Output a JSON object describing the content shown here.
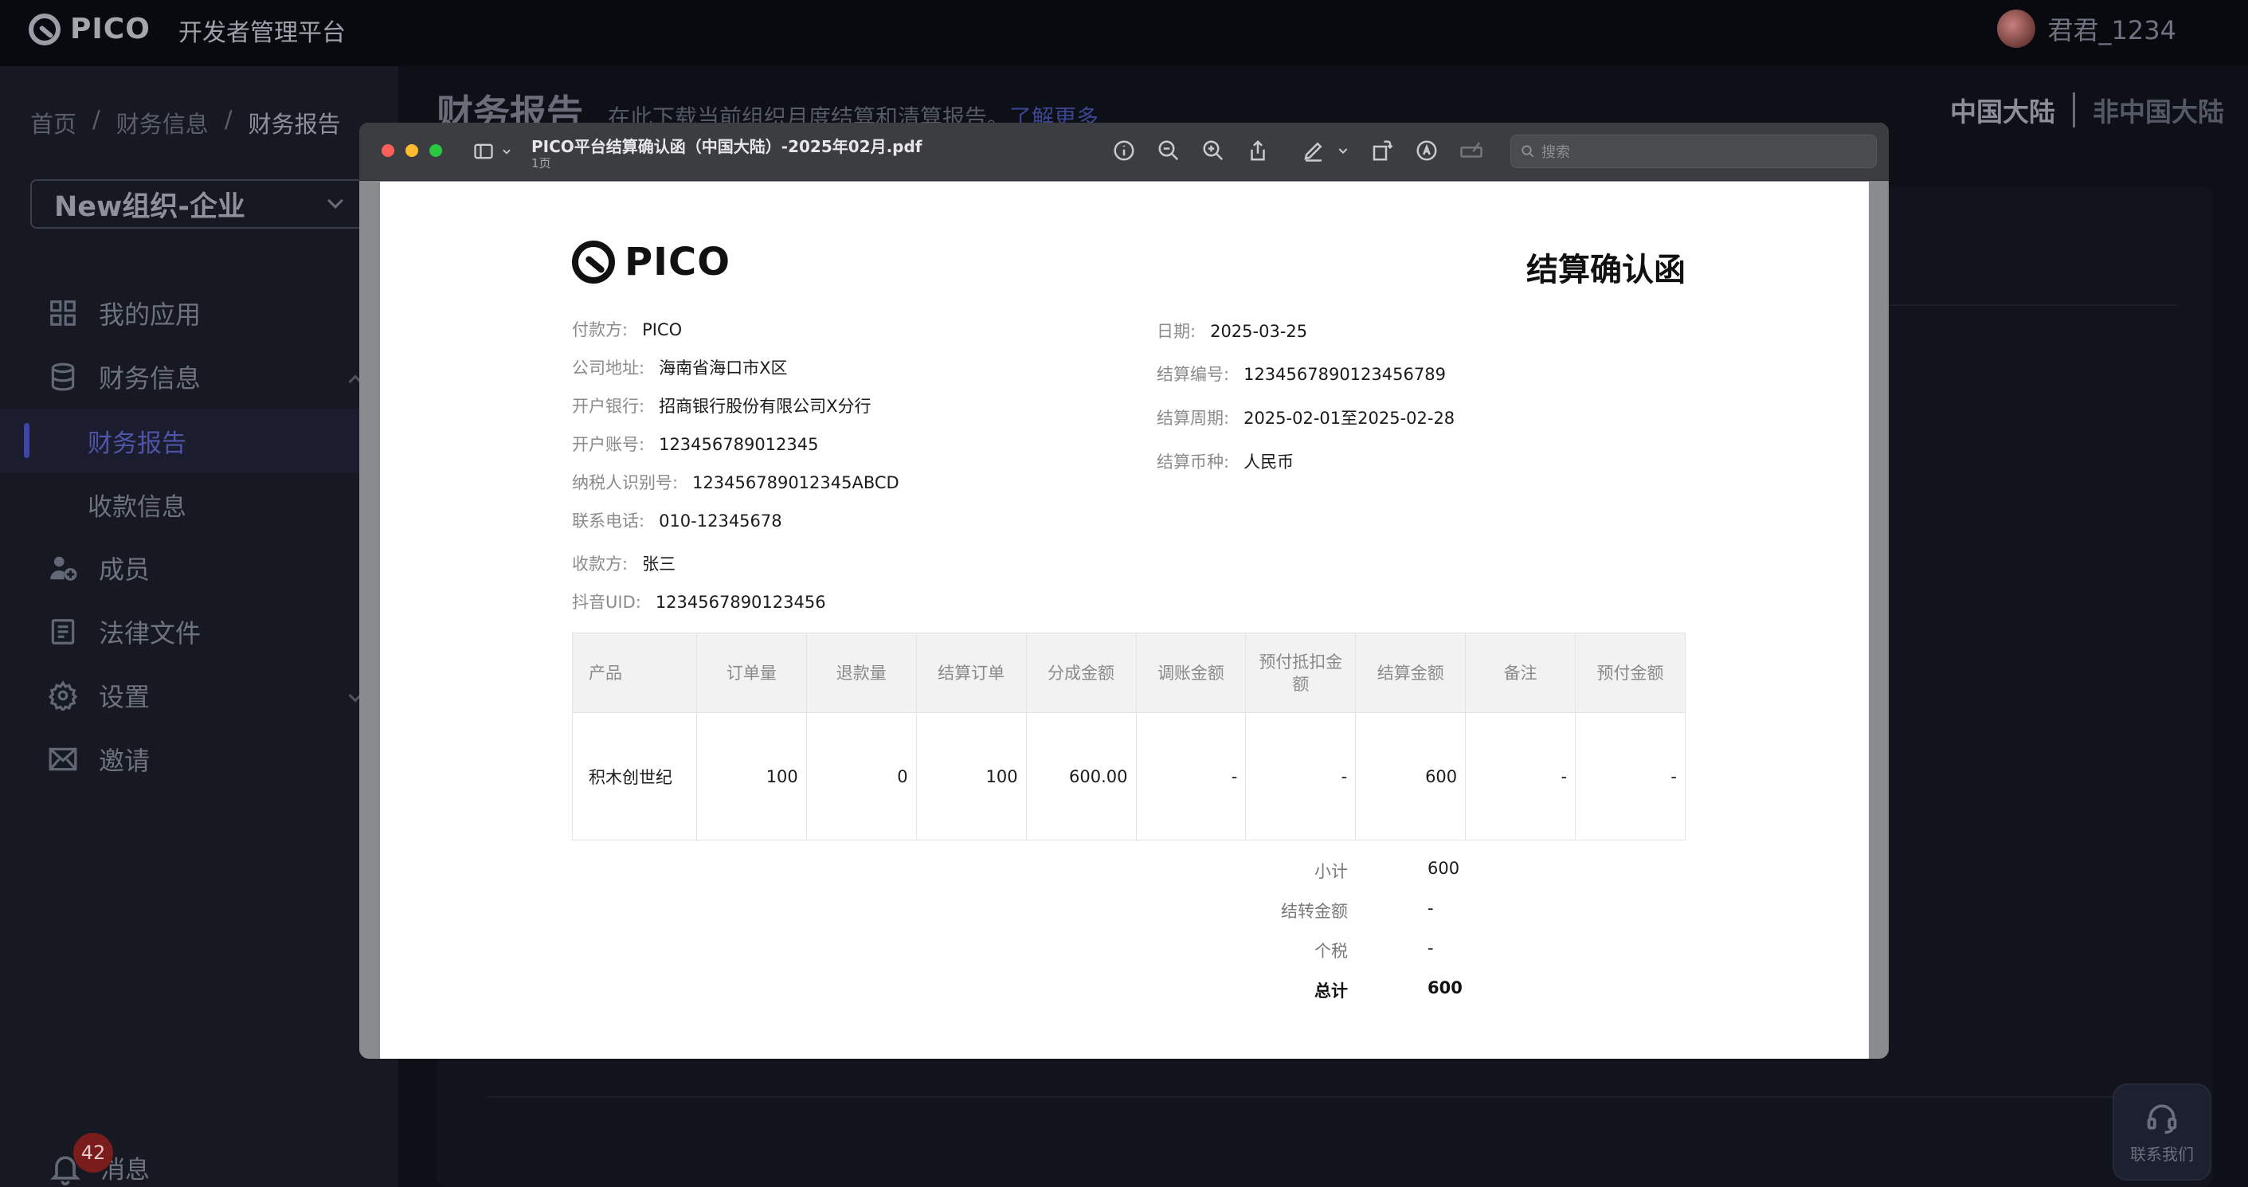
{
  "topbar": {
    "logo_text": "PICO",
    "platform_title": "开发者管理平台",
    "user_name": "君君_1234"
  },
  "breadcrumb": [
    "首页",
    "/",
    "财务信息",
    "/",
    "财务报告"
  ],
  "org_select": {
    "value": "New组织-企业"
  },
  "nav": {
    "my_apps": "我的应用",
    "finance": "财务信息",
    "finance_report": "财务报告",
    "payment_info": "收款信息",
    "members": "成员",
    "legal": "法律文件",
    "settings": "设置",
    "invite": "邀请"
  },
  "messages": {
    "label": "消息",
    "count": "42"
  },
  "main": {
    "title": "财务报告",
    "desc": "在此下载当前组织月度结算和清算报告。",
    "learn_more": "了解更多",
    "region_cn": "中国大陆",
    "region_non_cn": "非中国大陆"
  },
  "contact": {
    "label": "联系我们"
  },
  "pdf_window": {
    "title": "PICO平台结算确认函（中国大陆）-2025年02月.pdf",
    "pages": "1页",
    "search_placeholder": "搜索"
  },
  "document": {
    "logo_text": "PICO",
    "heading": "结算确认函",
    "payer": {
      "label": "付款方:",
      "value": "PICO"
    },
    "address": {
      "label": "公司地址:",
      "value": "海南省海口市X区"
    },
    "bank": {
      "label": "开户银行:",
      "value": "招商银行股份有限公司X分行"
    },
    "account": {
      "label": "开户账号:",
      "value": "123456789012345"
    },
    "tax_id": {
      "label": "纳税人识别号:",
      "value": "123456789012345ABCD"
    },
    "phone": {
      "label": "联系电话:",
      "value": "010-12345678"
    },
    "payee": {
      "label": "收款方:",
      "value": "张三"
    },
    "douyin_uid": {
      "label": "抖音UID:",
      "value": "1234567890123456"
    },
    "date": {
      "label": "日期:",
      "value": "2025-03-25"
    },
    "settlement_no": {
      "label": "结算编号:",
      "value": "1234567890123456789"
    },
    "period": {
      "label": "结算周期:",
      "value": "2025-02-01至2025-02-28"
    },
    "currency": {
      "label": "结算币种:",
      "value": "人民币"
    },
    "table": {
      "headers": [
        "产品",
        "订单量",
        "退款量",
        "结算订单",
        "分成金额",
        "调账金额",
        "预付抵扣金额",
        "结算金额",
        "备注",
        "预付金额"
      ],
      "rows": [
        [
          "积木创世纪",
          "100",
          "0",
          "100",
          "600.00",
          "-",
          "-",
          "600",
          "-",
          "-"
        ]
      ]
    },
    "summary": {
      "subtotal": {
        "label": "小计",
        "value": "600"
      },
      "carryover": {
        "label": "结转金额",
        "value": "-"
      },
      "tax": {
        "label": "个税",
        "value": "-"
      },
      "total": {
        "label": "总计",
        "value": "600"
      }
    }
  }
}
